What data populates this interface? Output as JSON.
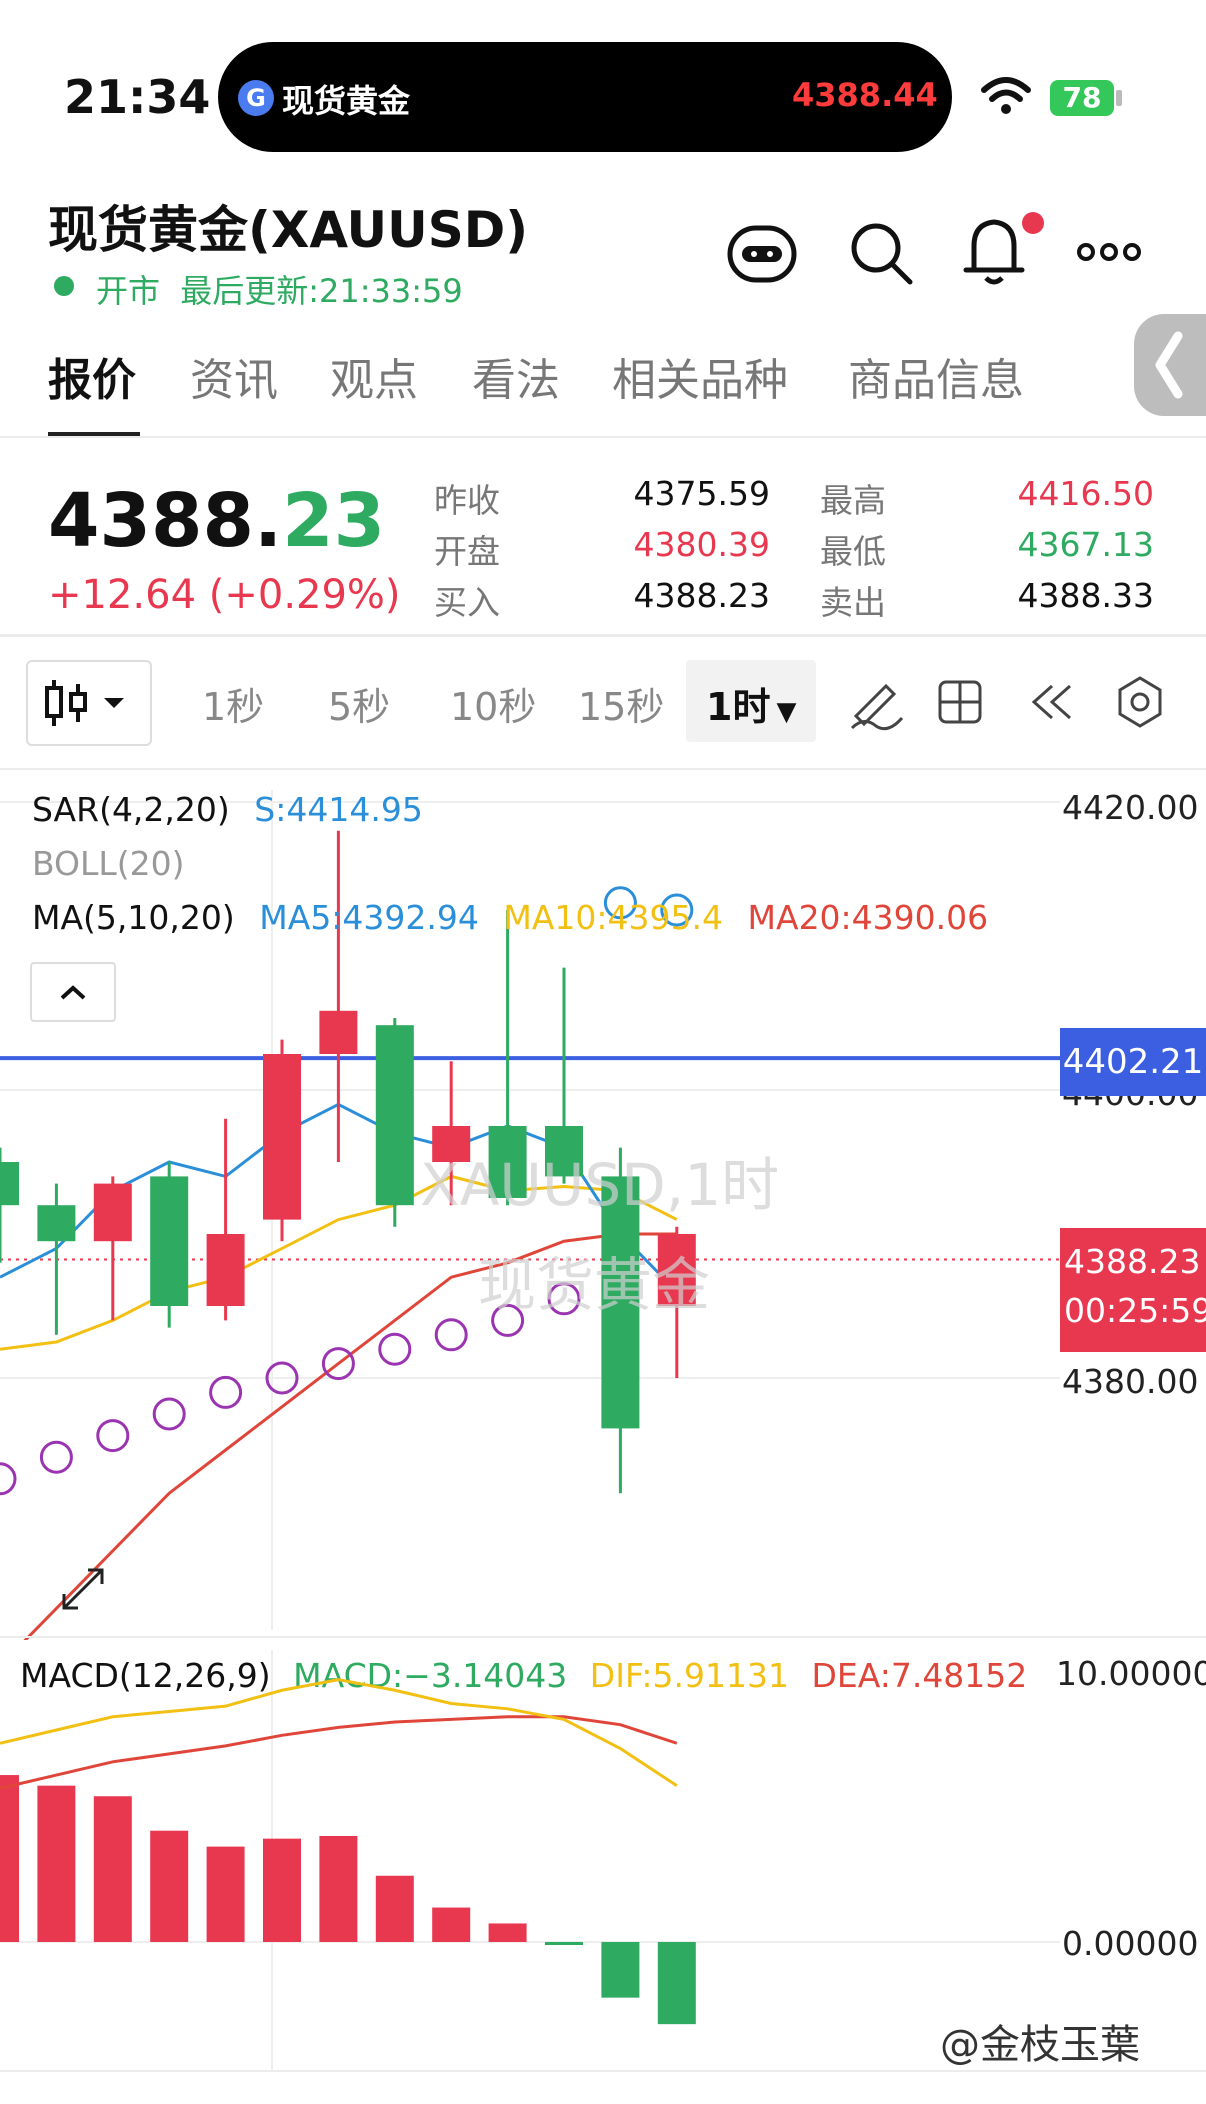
{
  "status_bar": {
    "time": "21:34",
    "island_app": "现货黄金",
    "island_price": "4388.44",
    "battery": "78"
  },
  "header": {
    "title": "现货黄金(XAUUSD)",
    "market_status": "开市",
    "last_update": "最后更新:21:33:59"
  },
  "tabs": [
    "报价",
    "资讯",
    "观点",
    "看法",
    "相关品种",
    "商品信息"
  ],
  "quote": {
    "price_int": "4388.",
    "price_dec": "23",
    "change": "+12.64 (+0.29%)",
    "rows": [
      {
        "l1": "昨收",
        "v1": "4375.59",
        "l2": "最高",
        "v2": "4416.50"
      },
      {
        "l1": "开盘",
        "v1": "4380.39",
        "l2": "最低",
        "v2": "4367.13"
      },
      {
        "l1": "买入",
        "v1": "4388.23",
        "l2": "卖出",
        "v2": "4388.33"
      }
    ]
  },
  "timeframes": [
    "1秒",
    "5秒",
    "10秒",
    "15秒",
    "1时"
  ],
  "indicators": {
    "sar_name": "SAR(4,2,20)",
    "sar_val": "S:4414.95",
    "boll_name": "BOLL(20)",
    "ma_name": "MA(5,10,20)",
    "ma5": "MA5:4392.94",
    "ma10": "MA10:4395.4",
    "ma20": "MA20:4390.06",
    "macd_name": "MACD(12,26,9)",
    "macd": "MACD:−3.14043",
    "dif": "DIF:5.91131",
    "dea": "DEA:7.48152"
  },
  "price_axis": {
    "top": "4420.00",
    "mid": "4400.00",
    "low": "4380.00",
    "highlight": "4402.21",
    "current": "4388.23",
    "countdown": "00:25:59"
  },
  "macd_axis": {
    "top": "10.00000",
    "zero": "0.00000"
  },
  "watermark": {
    "line1": "XAUUSD,1时",
    "line2": "现货黄金"
  },
  "brand": "@金枝玉葉",
  "colors": {
    "up": "#e8384f",
    "down": "#2eaa61",
    "ma5": "#2a8fd8",
    "ma10": "#f2c012",
    "ma20": "#e0453a",
    "sar": "#9a34b0",
    "highlight_line": "#3b5fe0"
  },
  "chart_data": {
    "type": "candlestick",
    "price_range": [
      4360,
      4425
    ],
    "candles": [
      {
        "open": 4395.0,
        "close": 4392.0,
        "high": 4396.0,
        "low": 4388.0
      },
      {
        "open": 4392.0,
        "close": 4389.5,
        "high": 4393.5,
        "low": 4383.0
      },
      {
        "open": 4389.5,
        "close": 4393.5,
        "high": 4394.0,
        "low": 4384.0
      },
      {
        "open": 4394.0,
        "close": 4385.0,
        "high": 4395.0,
        "low": 4383.5
      },
      {
        "open": 4385.0,
        "close": 4390.0,
        "high": 4398.0,
        "low": 4384.0
      },
      {
        "open": 4391.0,
        "close": 4402.5,
        "high": 4403.5,
        "low": 4389.5
      },
      {
        "open": 4402.5,
        "close": 4405.5,
        "high": 4418.0,
        "low": 4395.0
      },
      {
        "open": 4404.5,
        "close": 4392.0,
        "high": 4405.0,
        "low": 4390.5
      },
      {
        "open": 4395.0,
        "close": 4397.5,
        "high": 4402.0,
        "low": 4392.0
      },
      {
        "open": 4397.5,
        "close": 4392.5,
        "high": 4412.5,
        "low": 4392.0
      },
      {
        "open": 4397.5,
        "close": 4394.0,
        "high": 4408.5,
        "low": 4393.5
      },
      {
        "open": 4394.0,
        "close": 4376.5,
        "high": 4396.0,
        "low": 4372.0
      },
      {
        "open": 4385.0,
        "close": 4390.0,
        "high": 4390.5,
        "low": 4380.0
      }
    ],
    "ma5": [
      4387,
      4389,
      4393,
      4395,
      4394,
      4397,
      4399,
      4397,
      4396,
      4397.5,
      4396,
      4390,
      4386
    ],
    "ma10": [
      4382,
      4382.5,
      4384,
      4386,
      4387,
      4389,
      4391,
      4392,
      4394,
      4393,
      4393.3,
      4393,
      4391
    ],
    "ma20": [
      4360,
      4364,
      4368,
      4372,
      4375,
      4378,
      4381,
      4384,
      4387,
      4388,
      4389.5,
      4390,
      4390
    ],
    "sar": [
      4373.0,
      4374.5,
      4376.0,
      4377.5,
      4379.0,
      4380.0,
      4381.0,
      4382.0,
      4383.0,
      4384.0,
      4385.5,
      4413.0,
      4412.5
    ],
    "macd_hist": [
      6.3,
      5.9,
      5.5,
      4.2,
      3.6,
      3.9,
      4.0,
      2.5,
      1.3,
      0.7,
      -0.1,
      -2.1,
      -3.1
    ],
    "dif": [
      7.5,
      8.0,
      8.5,
      8.7,
      8.9,
      9.5,
      9.9,
      9.5,
      9.0,
      8.8,
      8.4,
      7.3,
      5.9
    ],
    "dea": [
      5.8,
      6.3,
      6.8,
      7.1,
      7.4,
      7.8,
      8.1,
      8.3,
      8.4,
      8.5,
      8.5,
      8.2,
      7.5
    ],
    "macd_range": [
      -4,
      10
    ]
  }
}
